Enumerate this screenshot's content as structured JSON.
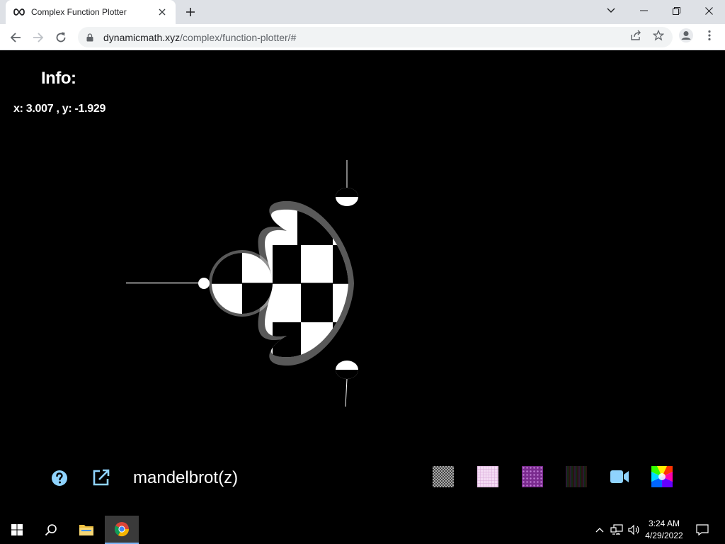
{
  "browser": {
    "tab_title": "Complex Function Plotter",
    "url_host": "dynamicmath.xyz",
    "url_path": "/complex/function-plotter/#"
  },
  "page": {
    "info_title": "Info:",
    "coords_text": "x: 3.007 , y: -1.929",
    "function_label": "mandelbrot(z)"
  },
  "colors": {
    "accent": "#8fd3fe",
    "background": "#000000"
  },
  "icons": {
    "help": "help-icon",
    "open_external": "open-external-icon",
    "record": "video-camera-icon",
    "color_wheel": "color-wheel-icon"
  },
  "taskbar": {
    "time": "3:24 AM",
    "date": "4/29/2022"
  }
}
